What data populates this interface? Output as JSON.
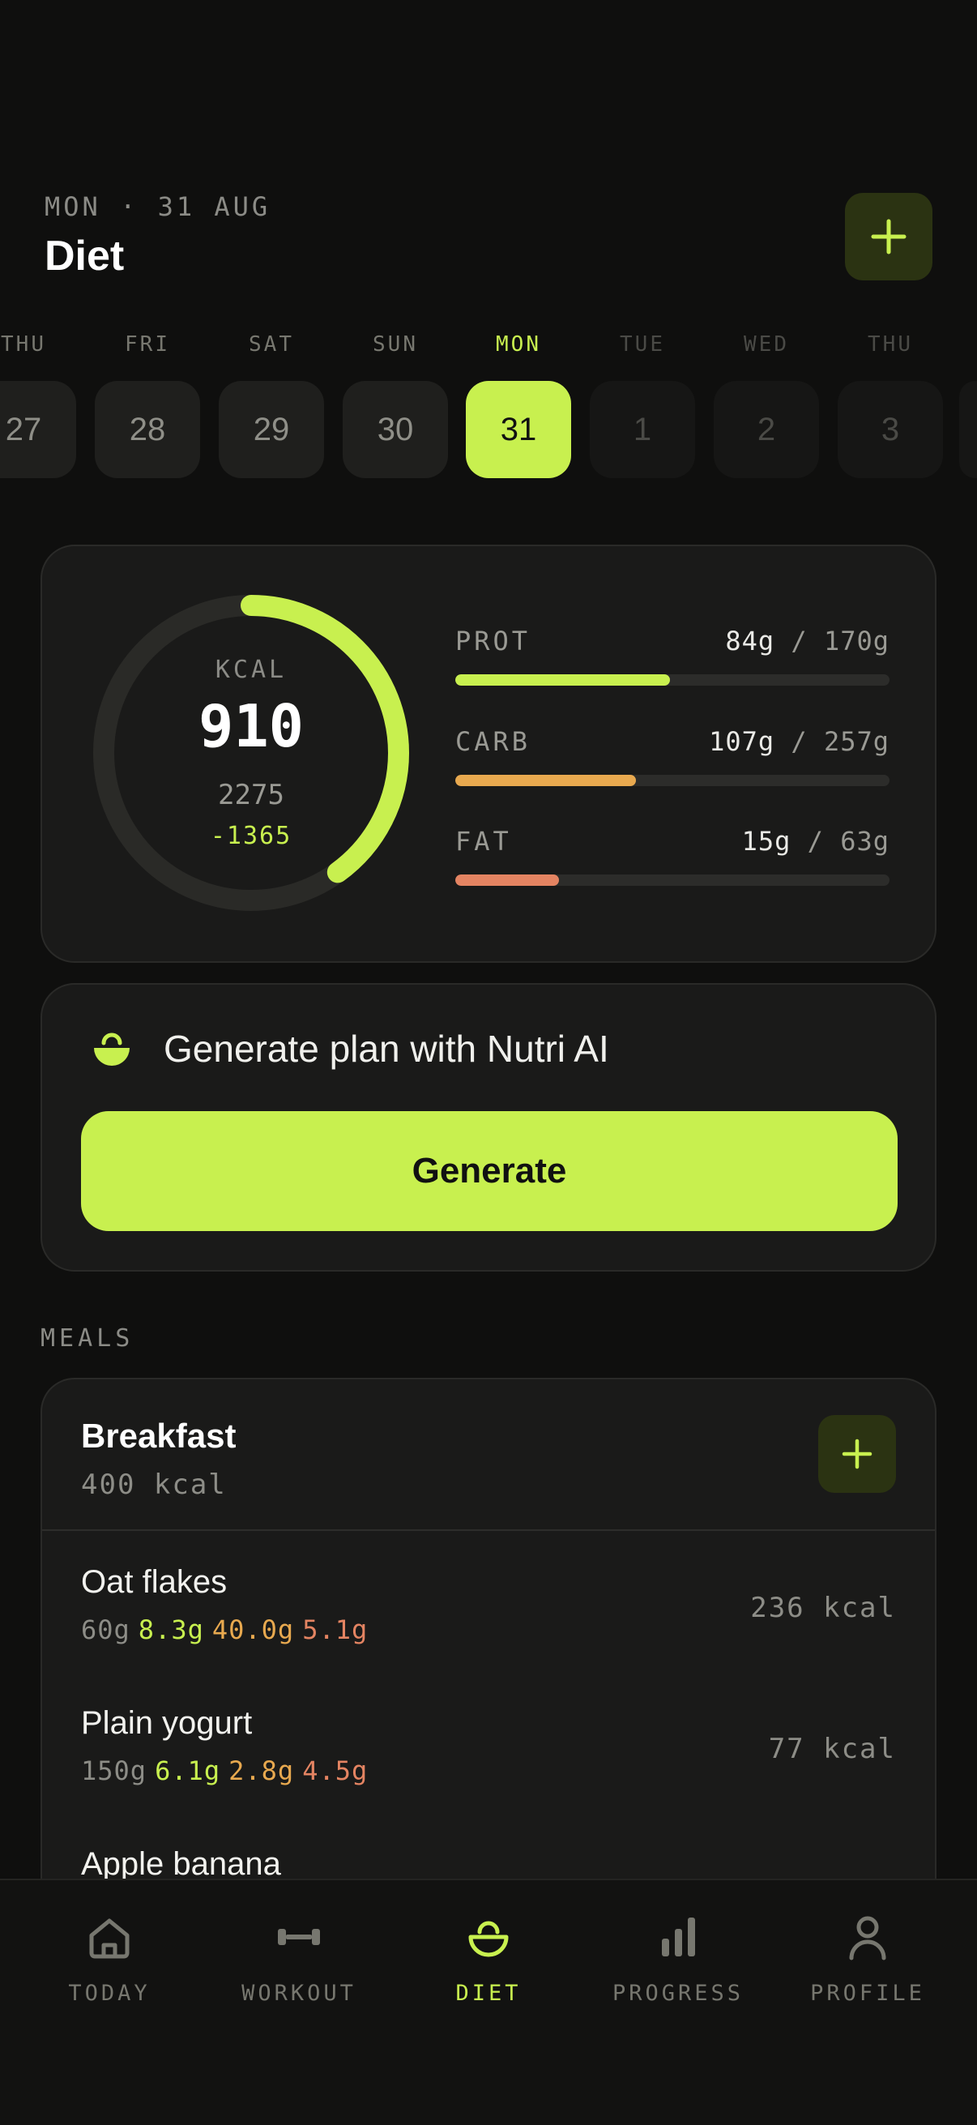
{
  "header": {
    "date_label": "MON · 31 AUG",
    "title": "Diet",
    "add_label": "+"
  },
  "week": [
    {
      "name": "THU",
      "num": "27",
      "state": "past"
    },
    {
      "name": "FRI",
      "num": "28",
      "state": "past"
    },
    {
      "name": "SAT",
      "num": "29",
      "state": "past"
    },
    {
      "name": "SUN",
      "num": "30",
      "state": "past"
    },
    {
      "name": "MON",
      "num": "31",
      "state": "active"
    },
    {
      "name": "TUE",
      "num": "1",
      "state": "future"
    },
    {
      "name": "WED",
      "num": "2",
      "state": "future"
    },
    {
      "name": "THU",
      "num": "3",
      "state": "future"
    }
  ],
  "summary": {
    "kcal_label": "KCAL",
    "kcal_value": "910",
    "kcal_target": "2275",
    "kcal_remaining": "-1365",
    "ring_progress": 0.4,
    "macros": [
      {
        "name": "PROT",
        "value": "84g",
        "target": "170g",
        "progress": 0.494,
        "color": "#c8f04f"
      },
      {
        "name": "CARB",
        "value": "107g",
        "target": "257g",
        "progress": 0.416,
        "color": "#e8a94f"
      },
      {
        "name": "FAT",
        "value": "15g",
        "target": "63g",
        "progress": 0.238,
        "color": "#e48462"
      }
    ]
  },
  "ai": {
    "text": "Generate plan with Nutri AI",
    "button_label": "Generate"
  },
  "meals_label": "MEALS",
  "meal": {
    "title": "Breakfast",
    "kcal": "400 kcal",
    "add_label": "+",
    "foods": [
      {
        "name": "Oat flakes",
        "qty": "60g",
        "p": "8.3g",
        "c": "40.0g",
        "f": "5.1g",
        "kcal": "236 kcal"
      },
      {
        "name": "Plain yogurt",
        "qty": "150g",
        "p": "6.1g",
        "c": "2.8g",
        "f": "4.5g",
        "kcal": "77 kcal"
      },
      {
        "name": "Apple banana",
        "qty": "",
        "p": "",
        "c": "",
        "f": "",
        "kcal": ""
      }
    ]
  },
  "nav": [
    {
      "label": "TODAY",
      "icon": "home-icon"
    },
    {
      "label": "WORKOUT",
      "icon": "dumbbell-icon"
    },
    {
      "label": "DIET",
      "icon": "bowl-icon",
      "active": true
    },
    {
      "label": "PROGRESS",
      "icon": "bar-chart-icon"
    },
    {
      "label": "PROFILE",
      "icon": "user-icon"
    }
  ],
  "colors": {
    "accent": "#c8f04f",
    "protein": "#c8f04f",
    "carb": "#e8a94f",
    "fat": "#e48462",
    "background": "#0f0f0e"
  }
}
